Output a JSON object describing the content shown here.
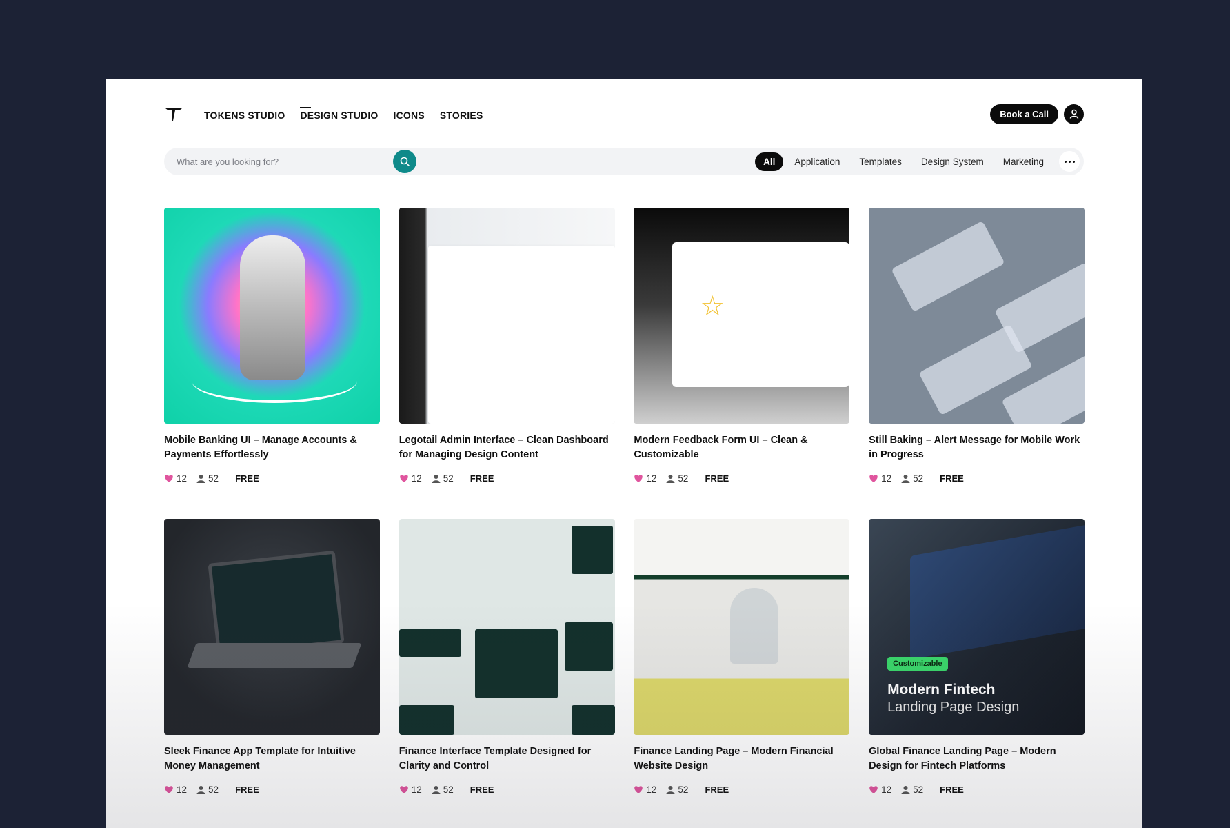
{
  "nav": {
    "items": [
      {
        "label": "TOKENS STUDIO"
      },
      {
        "label": "DESIGN STUDIO"
      },
      {
        "label": "ICONS"
      },
      {
        "label": "STORIES"
      }
    ],
    "book_call": "Book a Call"
  },
  "search": {
    "placeholder": "What are you looking for?"
  },
  "filters": [
    "All",
    "Application",
    "Templates",
    "Design System",
    "Marketing"
  ],
  "cards": [
    {
      "title": "Mobile Banking UI – Manage Accounts & Payments Effortlessly",
      "likes": "12",
      "users": "52",
      "price": "FREE"
    },
    {
      "title": "Legotail Admin Interface – Clean Dashboard for Managing Design Content",
      "likes": "12",
      "users": "52",
      "price": "FREE"
    },
    {
      "title": "Modern Feedback Form UI – Clean & Customizable",
      "likes": "12",
      "users": "52",
      "price": "FREE"
    },
    {
      "title": "Still Baking – Alert Message for Mobile Work in Progress",
      "likes": "12",
      "users": "52",
      "price": "FREE"
    },
    {
      "title": "Sleek Finance App Template for Intuitive Money Management",
      "likes": "12",
      "users": "52",
      "price": "FREE"
    },
    {
      "title": "Finance Interface Template Designed for Clarity and Control",
      "likes": "12",
      "users": "52",
      "price": "FREE"
    },
    {
      "title": "Finance Landing Page – Modern Financial Website Design",
      "likes": "12",
      "users": "52",
      "price": "FREE"
    },
    {
      "title": "Global Finance Landing Page – Modern Design for Fintech Platforms",
      "likes": "12",
      "users": "52",
      "price": "FREE"
    }
  ],
  "thumb8": {
    "badge": "Customizable",
    "title": "Modern Fintech",
    "subtitle": "Landing Page Design"
  },
  "colors": {
    "accent": "#0f8a8a",
    "heart": "#e0559e",
    "badge": "#3bd66b"
  }
}
